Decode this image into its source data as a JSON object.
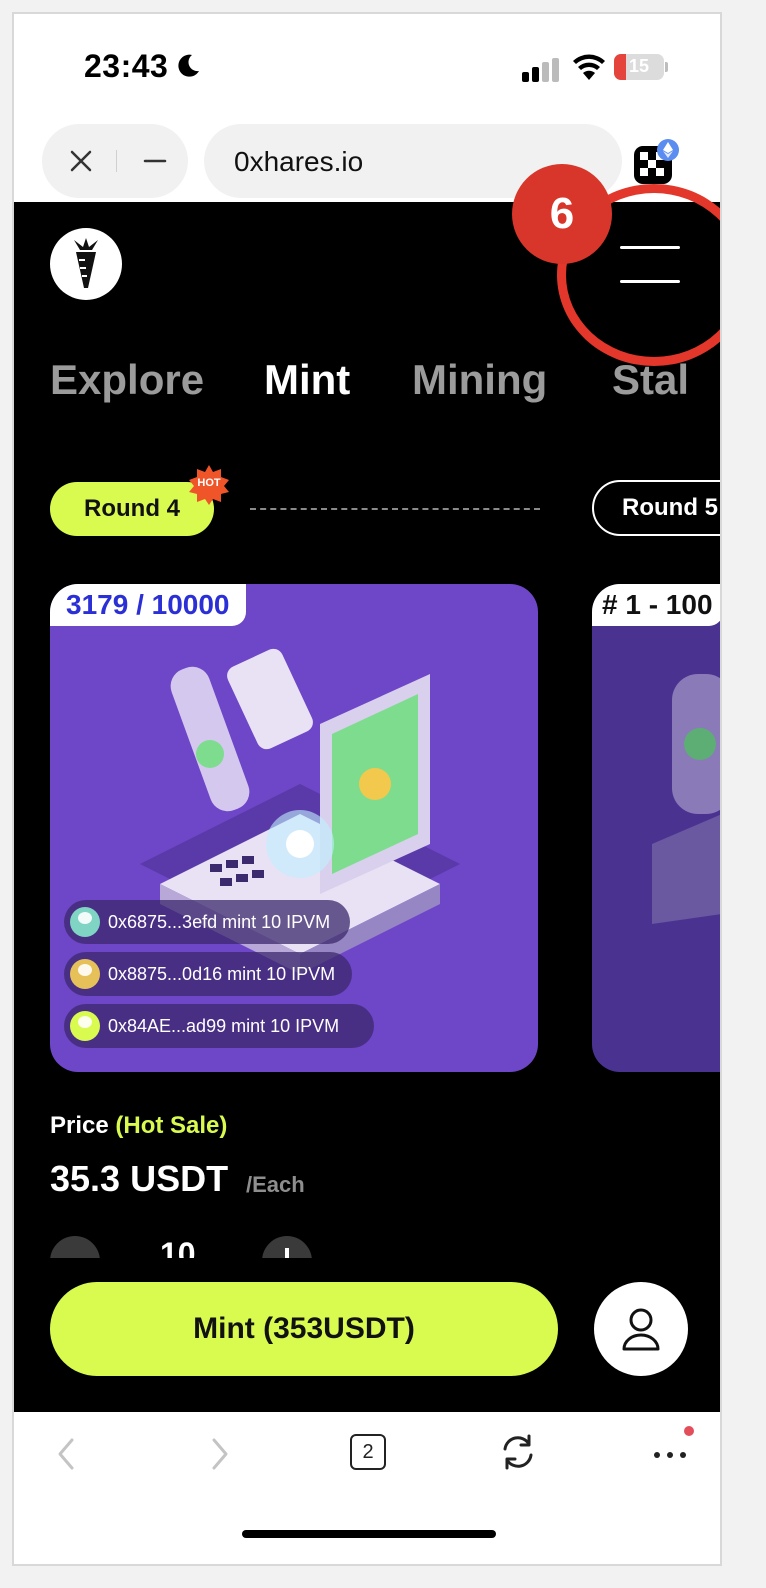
{
  "status_bar": {
    "time": "23:43",
    "battery": "15",
    "icons": [
      "moon-icon",
      "signal-icon",
      "wifi-icon",
      "battery-icon"
    ]
  },
  "browser": {
    "url": "0xhares.io",
    "icons": [
      "close-icon",
      "minimize-icon",
      "wallet-extension-icon"
    ]
  },
  "app": {
    "nav_tabs": [
      {
        "label": "Explore",
        "active": false
      },
      {
        "label": "Mint",
        "active": true
      },
      {
        "label": "Mining",
        "active": false
      },
      {
        "label": "Stal",
        "active": false
      }
    ],
    "rounds": {
      "current": "Round 4",
      "hot_badge": "HOT",
      "next": "Round 5"
    },
    "card_main": {
      "counter": "3179 / 10000",
      "feed": [
        {
          "text": "0x6875...3efd mint 10 IPVM",
          "avatar_color": "#7fd4c4"
        },
        {
          "text": "0x8875...0d16 mint 10 IPVM",
          "avatar_color": "#e6c15a"
        },
        {
          "text": "0x84AE...ad99 mint 10 IPVM",
          "avatar_color": "#d9fb4f"
        }
      ]
    },
    "card_next": {
      "counter": "# 1 - 100"
    },
    "price": {
      "label": "Price",
      "hot_label": "(Hot Sale)",
      "value": "35.3 USDT",
      "unit": "/Each"
    },
    "stepper": {
      "quantity": "10"
    },
    "mint_button": "Mint (353USDT)"
  },
  "annotation": {
    "badge": "6"
  },
  "bottom_nav": {
    "tab_count": "2",
    "icons": [
      "back-icon",
      "forward-icon",
      "tabs-icon",
      "reload-icon",
      "more-icon"
    ]
  },
  "colors": {
    "accent": "#d9fb4f",
    "card_purple": "#6e46c8",
    "annotation_red": "#e2372a",
    "counter_blue": "#2b2fd6"
  }
}
